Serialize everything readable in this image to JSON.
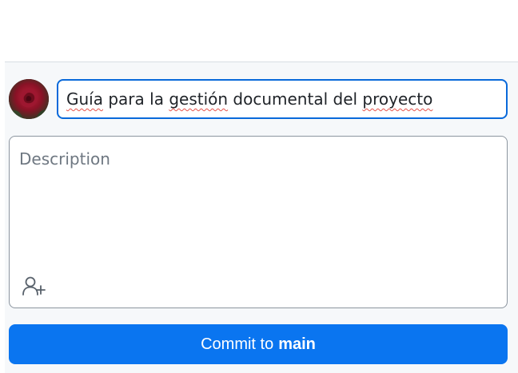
{
  "commit_form": {
    "summary_parts": [
      {
        "text": "Guía",
        "misspelled": true
      },
      {
        "text": " para la ",
        "misspelled": false
      },
      {
        "text": "gestión",
        "misspelled": true
      },
      {
        "text": " documental del ",
        "misspelled": false
      },
      {
        "text": "proyecto",
        "misspelled": true
      }
    ],
    "description_placeholder": "Description",
    "coauthor_icon": "person-add-icon",
    "commit_button": {
      "prefix": "Commit to",
      "branch": "main"
    },
    "avatar_icon": "user-avatar"
  },
  "colors": {
    "accent": "#0969da",
    "button": "#0a75f0",
    "panel_bg": "#f6f8fa",
    "spellcheck": "#e5534b"
  }
}
